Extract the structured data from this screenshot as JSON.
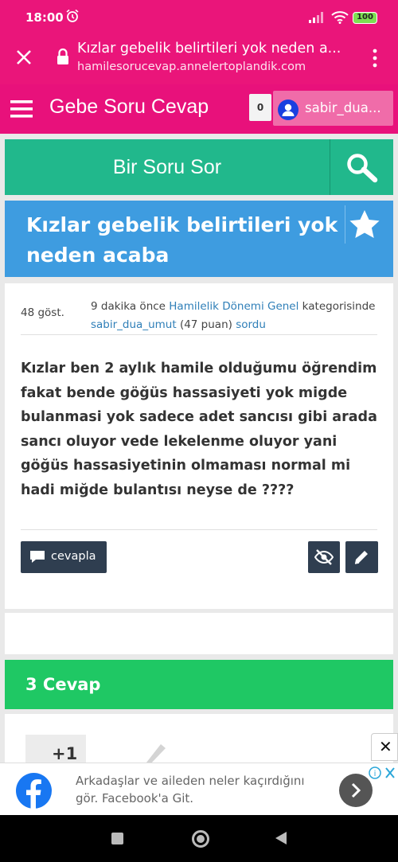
{
  "status_bar": {
    "time": "18:00",
    "battery": "100"
  },
  "browser": {
    "page_title": "Kızlar gebelik belirtileri yok neden a...",
    "url": "hamilesorucevap.annelertoplandik.com"
  },
  "site_header": {
    "brand": "Gebe Soru Cevap",
    "notification_count": "0",
    "username": "sabir_dua..."
  },
  "ask_bar": {
    "label": "Bir Soru Sor"
  },
  "question": {
    "title": "Kızlar gebelik belirtileri yok neden acaba",
    "views": "48 göst.",
    "time_ago": "9 dakika önce",
    "category": "Hamilelik Dönemi Genel",
    "category_suffix": "kategorisinde",
    "author": "sabir_dua_umut",
    "points": "(47 puan)",
    "action": "sordu",
    "body": "Kızlar ben 2 aylık hamile olduğumu öğrendim fakat bende göğüs hassasiyeti yok migde bulanmasi yok sadece adet sancısı gibi arada sancı oluyor vede lekelenme oluyor yani göğüs hassasiyetinin olmaması normal mi hadi miğde bulantısı neyse de ????",
    "reply_label": "cevapla"
  },
  "answers": {
    "count_label": "3 Cevap",
    "first_vote": "+1"
  },
  "ad": {
    "text": "Arkadaşlar ve aileden neler kaçırdığını gör. Facebook'a Git.",
    "close": "✕",
    "brand_color": "#1877f2"
  },
  "colors": {
    "header_pink": "#e8117b",
    "ask_green": "#21b88c",
    "title_blue": "#3e9ce0",
    "answers_green": "#1fc864",
    "button_dark": "#2f3e50"
  }
}
